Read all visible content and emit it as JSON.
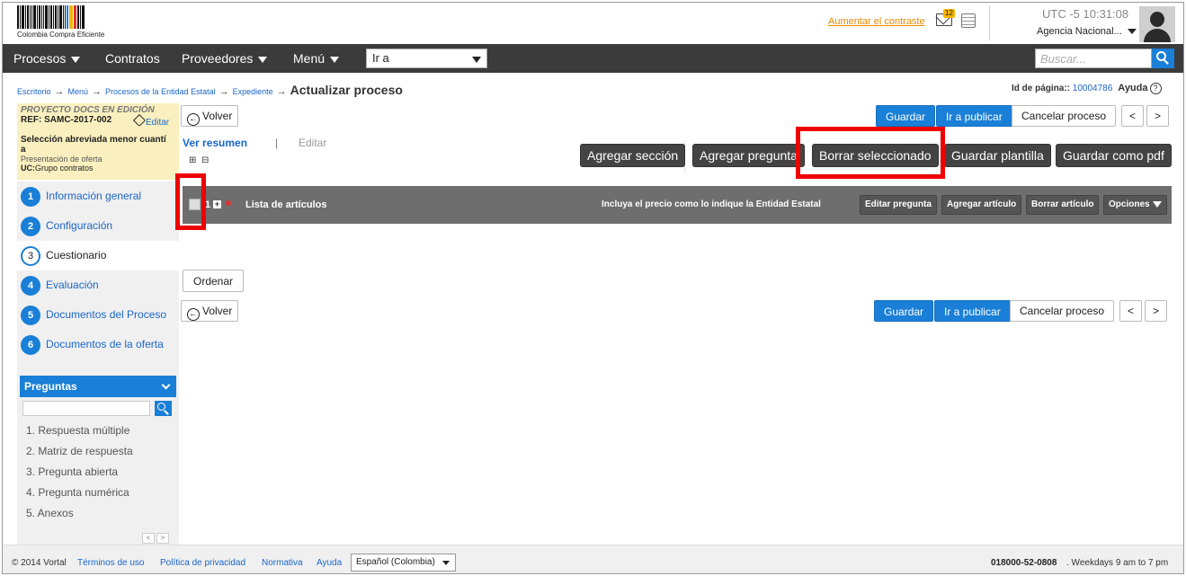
{
  "header": {
    "logo_text": "Colombia Compra Eficiente",
    "contrast_link": "Aumentar el contraste",
    "notifications_count": "12",
    "timezone": "UTC -5",
    "time": "10:31:08",
    "agency": "Agencia Nacional..."
  },
  "nav": {
    "items": [
      "Procesos",
      "Contratos",
      "Proveedores",
      "Menú"
    ],
    "goto_value": "Ir a",
    "search_placeholder": "Buscar..."
  },
  "breadcrumb": {
    "items": [
      "Escritorio",
      "Menú",
      "Procesos de la Entidad Estatal",
      "Expediente"
    ],
    "current": "Actualizar proceso"
  },
  "page_id": {
    "label": "Id de página::",
    "value": "10004786",
    "help": "Ayuda"
  },
  "process": {
    "status": "PROYECTO DOCS EN EDICIÓN",
    "ref": "REF: SAMC-2017-002",
    "edit": "Editar",
    "type_line1": "Selección abreviada menor cuantí",
    "type_line2": "a",
    "phase": "Presentación de oferta",
    "uc_label": "UC:",
    "uc_value": "Grupo contratos"
  },
  "steps": [
    {
      "num": "1",
      "label": "Información general"
    },
    {
      "num": "2",
      "label": "Configuración"
    },
    {
      "num": "3",
      "label": "Cuestionario"
    },
    {
      "num": "4",
      "label": "Evaluación"
    },
    {
      "num": "5",
      "label": "Documentos del Proceso"
    },
    {
      "num": "6",
      "label": "Documentos de la oferta"
    }
  ],
  "questions_panel": {
    "title": "Preguntas",
    "items": [
      "1. Respuesta múltiple",
      "2. Matriz de respuesta",
      "3. Pregunta abierta",
      "4. Pregunta numérica",
      "5. Anexos"
    ]
  },
  "toolbar": {
    "back": "Volver",
    "save": "Guardar",
    "publish": "Ir a publicar",
    "cancel": "Cancelar proceso",
    "prev": "<",
    "next": ">"
  },
  "tabs": {
    "summary": "Ver resumen",
    "separator": "|",
    "edit": "Editar"
  },
  "actions": {
    "add_section": "Agregar sección",
    "add_question": "Agregar pregunta",
    "delete_selected": "Borrar seleccionado",
    "save_template": "Guardar plantilla",
    "save_pdf": "Guardar como pdf"
  },
  "question_row": {
    "number": "1",
    "title": "Lista de artículos",
    "hint": "Incluya el precio como lo indique la Entidad Estatal",
    "edit_question": "Editar pregunta",
    "add_item": "Agregar artículo",
    "delete_item": "Borrar artículo",
    "options": "Opciones"
  },
  "order_button": "Ordenar",
  "footer": {
    "copyright": "© 2014 Vortal",
    "links": [
      "Términos de uso",
      "Política de privacidad",
      "Normativa",
      "Ayuda"
    ],
    "language": "Español (Colombia)",
    "phone": "018000-52-0808",
    "hours": ". Weekdays 9 am to 7 pm"
  },
  "colors": {
    "accent": "#1a7fd6",
    "dark_nav": "#3b3b3b",
    "highlight": "#e00000"
  }
}
